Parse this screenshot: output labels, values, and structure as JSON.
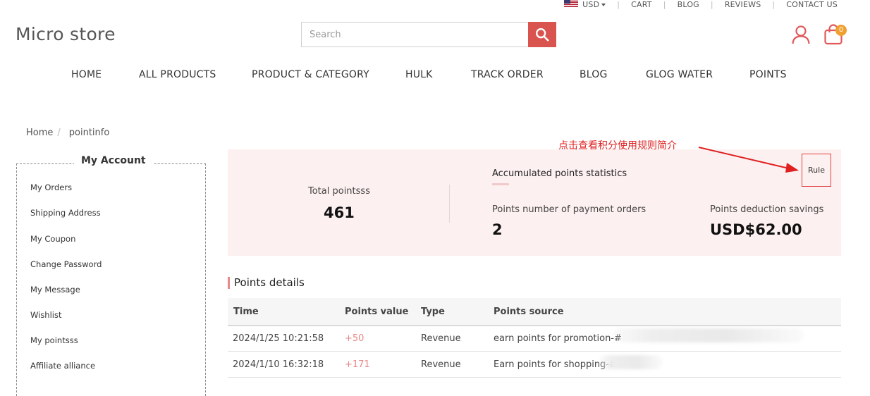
{
  "topbar": {
    "currency": "USD",
    "links": [
      "CART",
      "BLOG",
      "REVIEWS",
      "CONTACT US"
    ]
  },
  "header": {
    "logo": "Micro store",
    "search_placeholder": "Search",
    "cart_count": "0"
  },
  "nav": [
    "HOME",
    "ALL PRODUCTS",
    "PRODUCT & CATEGORY",
    "HULK",
    "TRACK ORDER",
    "BLOG",
    "GLOG WATER",
    "POINTS"
  ],
  "breadcrumb": {
    "home": "Home",
    "current": "pointinfo"
  },
  "sidebar": {
    "title": "My Account",
    "items": [
      "My Orders",
      "Shipping Address",
      "My Coupon",
      "Change Password",
      "My Message",
      "Wishlist",
      "My pointsss",
      "Affiliate alliance"
    ]
  },
  "stats": {
    "total_label": "Total pointsss",
    "total_value": "461",
    "accumulated_title": "Accumulated points statistics",
    "orders_label": "Points number of payment orders",
    "orders_value": "2",
    "savings_label": "Points deduction savings",
    "savings_value": "USD$62.00",
    "rule_label": "Rule",
    "annotation": "点击查看积分使用规则简介"
  },
  "details": {
    "title": "Points details",
    "columns": [
      "Time",
      "Points value",
      "Type",
      "Points source"
    ],
    "rows": [
      {
        "time": "2024/1/25 10:21:58",
        "points": "+50",
        "type": "Revenue",
        "source": "earn points for promotion-#"
      },
      {
        "time": "2024/1/10 16:32:18",
        "points": "+171",
        "type": "Revenue",
        "source": "Earn points for shopping-#"
      }
    ]
  },
  "colors": {
    "accent": "#d9534f",
    "panel_bg": "#fdf0f0",
    "badge": "#f0a030",
    "annotation": "#e02020"
  }
}
